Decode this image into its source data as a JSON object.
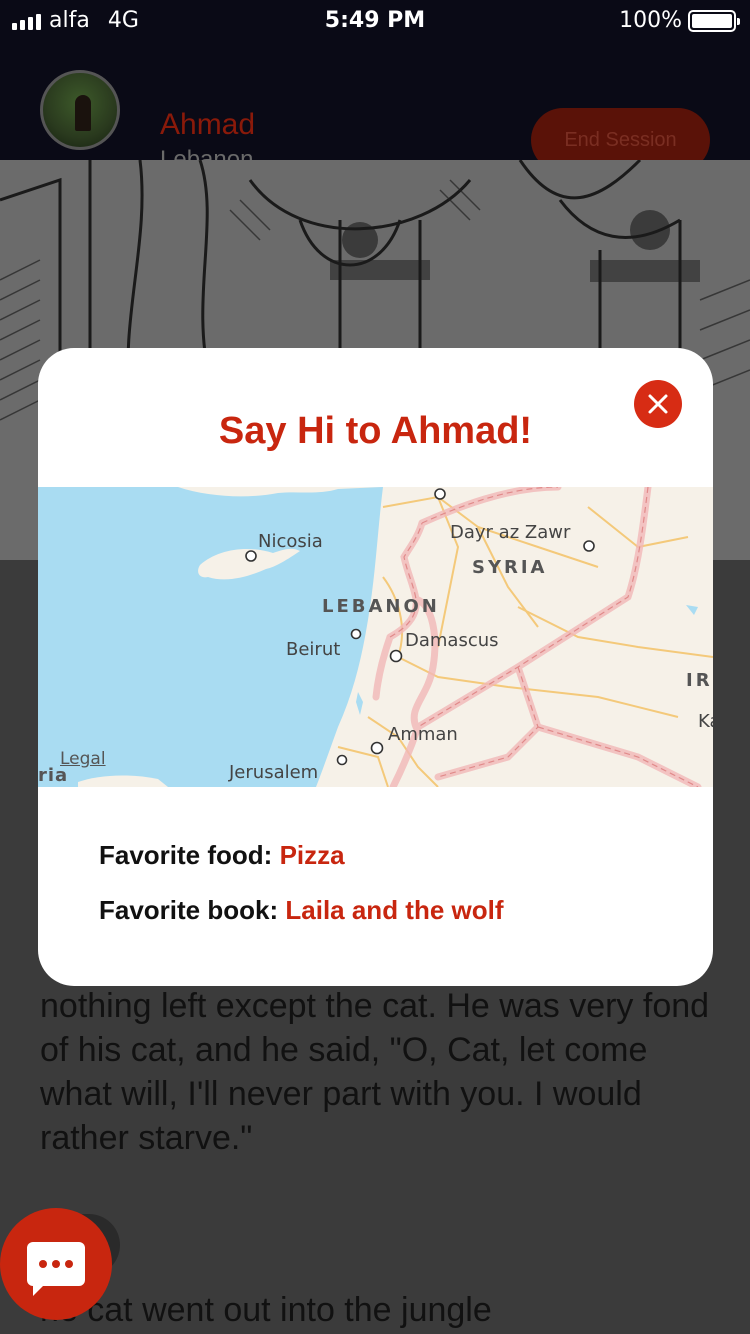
{
  "status_bar": {
    "carrier": "alfa",
    "network": "4G",
    "time": "5:49 PM",
    "battery": "100%"
  },
  "header": {
    "name": "Ahmad",
    "country": "Lebanon",
    "end_session": "End Session"
  },
  "story": {
    "paragraph": "nothing left except the cat. He was very fond of his cat, and he said, \"O, Cat, let come what will, I'll never part with you. I would rather starve.\"",
    "next_line": "he cat went out into the jungle"
  },
  "modal": {
    "title": "Say Hi to Ahmad!",
    "map": {
      "labels": {
        "nicosia": "Nicosia",
        "dayr": "Dayr az Zawr",
        "syria": "SYRIA",
        "lebanon": "LEBANON",
        "beirut": "Beirut",
        "damascus": "Damascus",
        "amman": "Amman",
        "jerusalem": "Jerusalem",
        "ir": "IR",
        "ka": "Ka",
        "ria": "ria"
      },
      "legal": "Legal"
    },
    "favorites": {
      "food_label": "Favorite food:",
      "food_value": "Pizza",
      "book_label": "Favorite book:",
      "book_value": "Laila and the wolf"
    }
  },
  "icons": {
    "close": "close-icon",
    "chat": "chat-icon",
    "avatar": "avatar"
  },
  "colors": {
    "accent": "#c8260f",
    "header_bg": "#0a0a16",
    "map_water": "#a9dcf2"
  }
}
